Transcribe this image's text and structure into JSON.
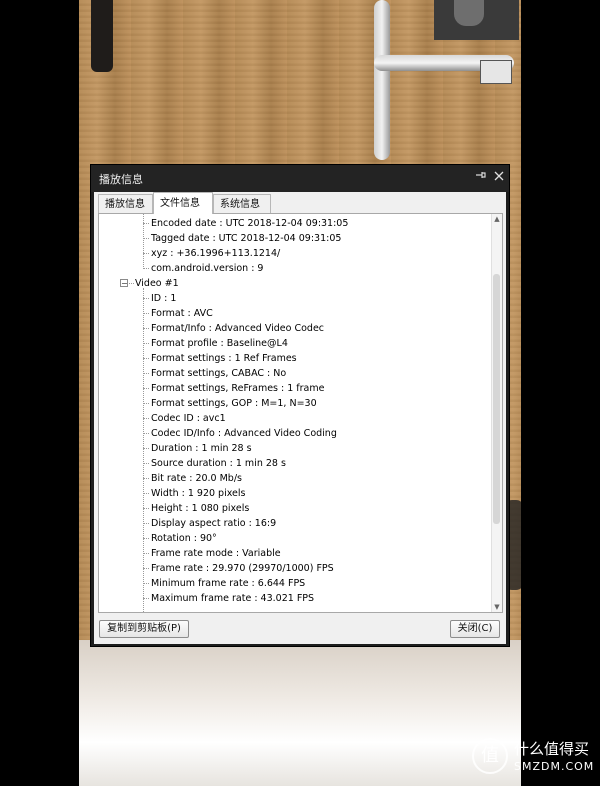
{
  "window": {
    "title": "播放信息",
    "pin_icon": "pin-icon",
    "close_icon": "close-icon"
  },
  "tabs": [
    {
      "label": "播放信息",
      "active": false
    },
    {
      "label": "文件信息",
      "active": true
    },
    {
      "label": "系统信息",
      "active": false
    }
  ],
  "tree": {
    "general_items": [
      "Encoded date : UTC 2018-12-04 09:31:05",
      "Tagged date : UTC 2018-12-04 09:31:05",
      "xyz : +36.1996+113.1214/",
      "com.android.version : 9"
    ],
    "video_node": {
      "label": "Video #1",
      "expanded": true
    },
    "video_items": [
      "ID : 1",
      "Format : AVC",
      "Format/Info : Advanced Video Codec",
      "Format profile : Baseline@L4",
      "Format settings : 1 Ref Frames",
      "Format settings, CABAC : No",
      "Format settings, ReFrames : 1 frame",
      "Format settings, GOP : M=1, N=30",
      "Codec ID : avc1",
      "Codec ID/Info : Advanced Video Coding",
      "Duration : 1 min 28 s",
      "Source duration : 1 min 28 s",
      "Bit rate : 20.0 Mb/s",
      "Width : 1 920 pixels",
      "Height : 1 080 pixels",
      "Display aspect ratio : 16:9",
      "Rotation : 90°",
      "Frame rate mode : Variable",
      "Frame rate : 29.970 (29970/1000) FPS",
      "Minimum frame rate : 6.644 FPS",
      "Maximum frame rate : 43.021 FPS"
    ]
  },
  "buttons": {
    "copy": "复制到剪贴板(P)",
    "close": "关闭(C)"
  },
  "watermark": {
    "logo_glyph": "值",
    "cn": "什么值得买",
    "en": "SMZDM.COM"
  }
}
